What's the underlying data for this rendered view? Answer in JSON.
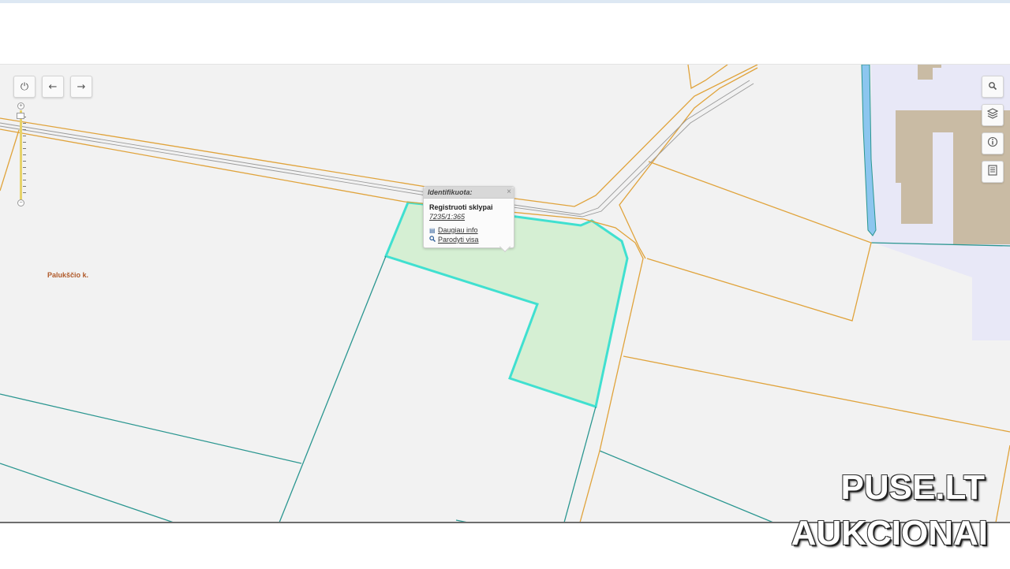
{
  "map": {
    "place_label": "Palukščio k.",
    "colors": {
      "background": "#f2f2f2",
      "road_boundary": "#e0a33b",
      "parcel_line": "#2a9690",
      "selected_fill": "#d5efd3",
      "selected_outline": "#40e0d0",
      "water": "#8cc6ef",
      "building": "#c9bba4",
      "industrial_zone": "#e8e8f7"
    }
  },
  "controls": {
    "left": [
      {
        "name": "power-icon",
        "glyph": "⏻"
      },
      {
        "name": "back-arrow-icon",
        "glyph": "←"
      },
      {
        "name": "forward-arrow-icon",
        "glyph": "→"
      }
    ],
    "right": [
      {
        "name": "search-icon",
        "glyph": "🔍"
      },
      {
        "name": "layers-icon",
        "glyph": "≋"
      },
      {
        "name": "info-icon",
        "glyph": "ⓘ"
      },
      {
        "name": "document-icon",
        "glyph": "≣"
      }
    ],
    "zoom_plus": "+",
    "zoom_minus": "−"
  },
  "popup": {
    "header": "Identifikuota:",
    "close": "×",
    "title": "Registruoti sklypai",
    "parcel_id": "7235/1:365",
    "more_info": "Daugiau info",
    "show_all": "Parodyti visa"
  },
  "watermark": {
    "line1": "PUSE.LT",
    "line2": "AUKCIONAI"
  }
}
